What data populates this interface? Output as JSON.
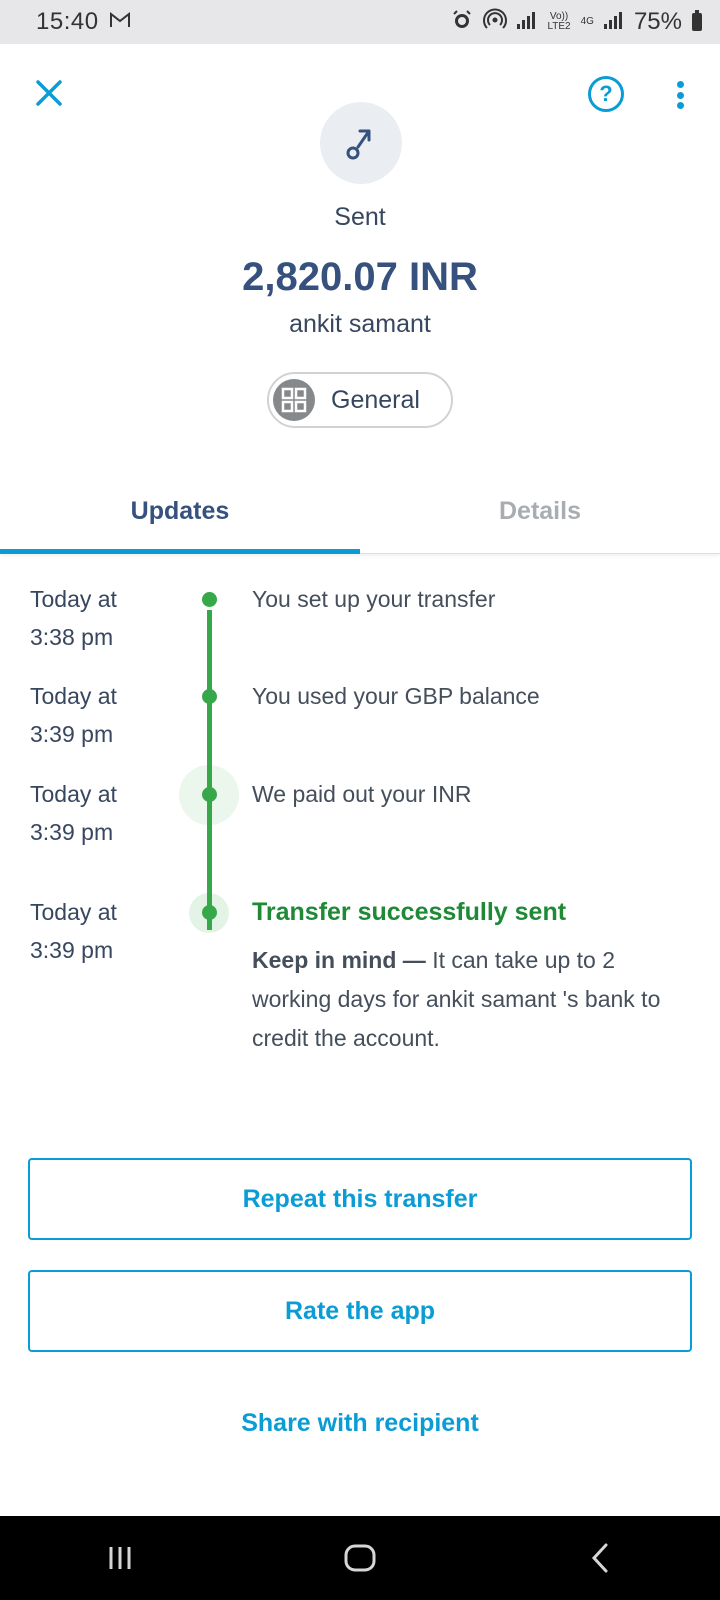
{
  "status_bar": {
    "time": "15:40",
    "notification_icon": "gmail-icon",
    "battery": "75%",
    "network_top": "Vo))",
    "network_bottom": "LTE2",
    "network2": "4G"
  },
  "header": {
    "close_icon": "close-icon",
    "help_icon": "help-icon",
    "help_label": "?",
    "more_icon": "more-vertical-icon"
  },
  "transfer": {
    "icon": "send-arrow-icon",
    "status": "Sent",
    "amount": "2,820.07 INR",
    "recipient": "ankit samant",
    "category": "General",
    "category_icon": "grid-icon"
  },
  "tabs": [
    {
      "label": "Updates",
      "active": true
    },
    {
      "label": "Details",
      "active": false
    }
  ],
  "timeline": [
    {
      "time_line1": "Today at",
      "time_line2": "3:38 pm",
      "text": "You set up your transfer"
    },
    {
      "time_line1": "Today at",
      "time_line2": "3:39 pm",
      "text": "You used your GBP balance"
    },
    {
      "time_line1": "Today at",
      "time_line2": "3:39 pm",
      "text": "We paid out your INR"
    },
    {
      "time_line1": "Today at",
      "time_line2": "3:39 pm",
      "text": "Transfer successfully sent",
      "note_bold": "Keep in mind —",
      "note": "It can take up to 2 working days for ankit samant 's bank to credit the account."
    }
  ],
  "actions": {
    "repeat": "Repeat this transfer",
    "rate": "Rate the app",
    "share": "Share with recipient"
  },
  "colors": {
    "accent": "#0a9cd4",
    "heading": "#37517e",
    "success": "#37a84a"
  },
  "nav_bar": {
    "recents_icon": "recents-icon",
    "home_icon": "home-icon",
    "back_icon": "back-icon"
  }
}
